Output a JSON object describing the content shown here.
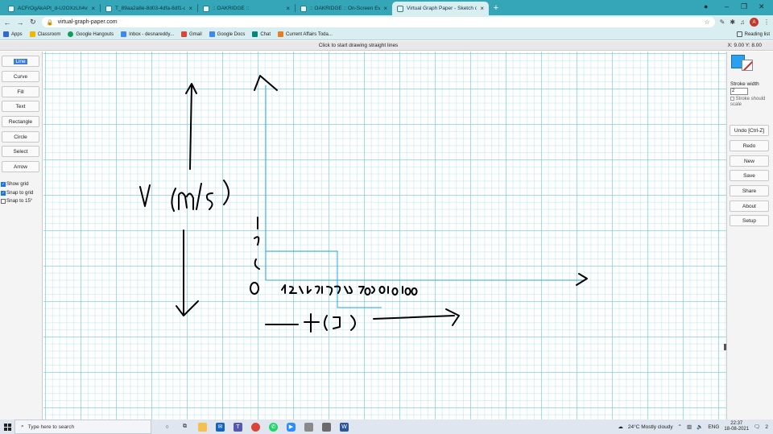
{
  "browser": {
    "tabs": [
      {
        "title": "ACFrOgAkAPt_d-U2OXzLh4vP..."
      },
      {
        "title": "T_89aa2a8e-8d03-4dfa-8df1-d3..."
      },
      {
        "title": ":: OAKRIDGE ::"
      },
      {
        "title": ":: OAKRIDGE :: On-Screen Evalu..."
      },
      {
        "title": "Virtual Graph Paper - Sketch on..."
      }
    ],
    "new_tab_label": "+",
    "url": "virtual-graph-paper.com",
    "avatar_letter": "A",
    "bookmarks": [
      {
        "label": "Apps",
        "color": "#3367d6"
      },
      {
        "label": "Classroom",
        "color": "#f4b400"
      },
      {
        "label": "Google Hangouts",
        "color": "#0f9d58"
      },
      {
        "label": "Inbox - desnareddy...",
        "color": "#4285f4"
      },
      {
        "label": "Gmail",
        "color": "#db4437"
      },
      {
        "label": "Google Docs",
        "color": "#4285f4"
      },
      {
        "label": "Chat",
        "color": "#00897b"
      },
      {
        "label": "Current Affairs Toda...",
        "color": "#e67e22"
      }
    ],
    "reading_list": "Reading list"
  },
  "page": {
    "status_message": "Click to start drawing straight lines",
    "coords": "X: 9.00  Y: 8.00"
  },
  "tools": {
    "items": [
      "Line",
      "Curve",
      "Fill",
      "Text",
      "Rectangle",
      "Circle",
      "Select",
      "Arrow"
    ],
    "selected": "Line",
    "options": [
      {
        "label": "Show grid",
        "checked": true
      },
      {
        "label": "Snap to grid",
        "checked": true
      },
      {
        "label": "Snap to 15°",
        "checked": false
      }
    ]
  },
  "right_panel": {
    "stroke_color": "#2aa0f0",
    "stroke_width_label": "Stroke width",
    "stroke_width_value": "2",
    "stroke_scale_label": "Stroke should scale",
    "buttons": [
      "Undo [Ctrl-Z]",
      "Redo",
      "New",
      "Save",
      "Share",
      "About",
      "Setup"
    ]
  },
  "drawing": {
    "y_label": "V (m/s)",
    "x_label": "t (s)",
    "origin": "0",
    "x_ticks": "10 20 30 40 50 60 70 80 90 100",
    "y_tick": "10"
  },
  "taskbar": {
    "search_placeholder": "Type here to search",
    "weather": "24°C  Mostly cloudy",
    "language": "ENG",
    "time": "22:37",
    "date": "18-08-2021",
    "notification_count": "2"
  }
}
